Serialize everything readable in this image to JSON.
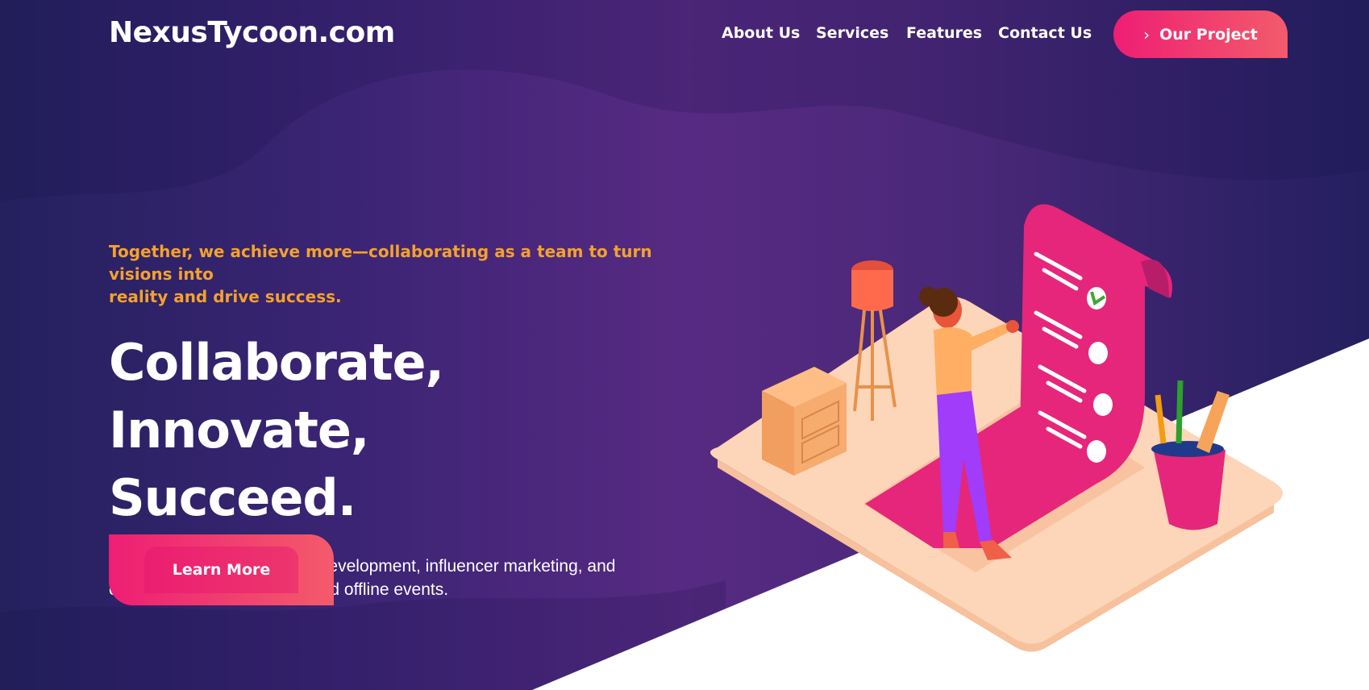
{
  "site": {
    "logo": "NexusTycoon.com"
  },
  "nav": {
    "items": [
      {
        "label": "About Us"
      },
      {
        "label": "Services"
      },
      {
        "label": "Features"
      },
      {
        "label": "Contact Us"
      }
    ],
    "cta_label": "Our Project",
    "cta_icon": "chevron-right-icon"
  },
  "hero": {
    "tagline_line1": "Together, we achieve more—collaborating as a team to turn visions into",
    "tagline_line2": "reality and drive success.",
    "headline_line1": "Collaborate, Innovate,",
    "headline_line2": "Succeed.",
    "description_line1": "Your expert in web and app development, influencer marketing, and",
    "description_line2": "organizing standout online and offline events.",
    "button_label": "Learn More"
  },
  "colors": {
    "accent_pink": "#ee1e74",
    "accent_coral": "#f35b6b",
    "tagline_orange": "#f4a12d",
    "background_purple": "#572a82",
    "background_navy": "#24215e"
  }
}
